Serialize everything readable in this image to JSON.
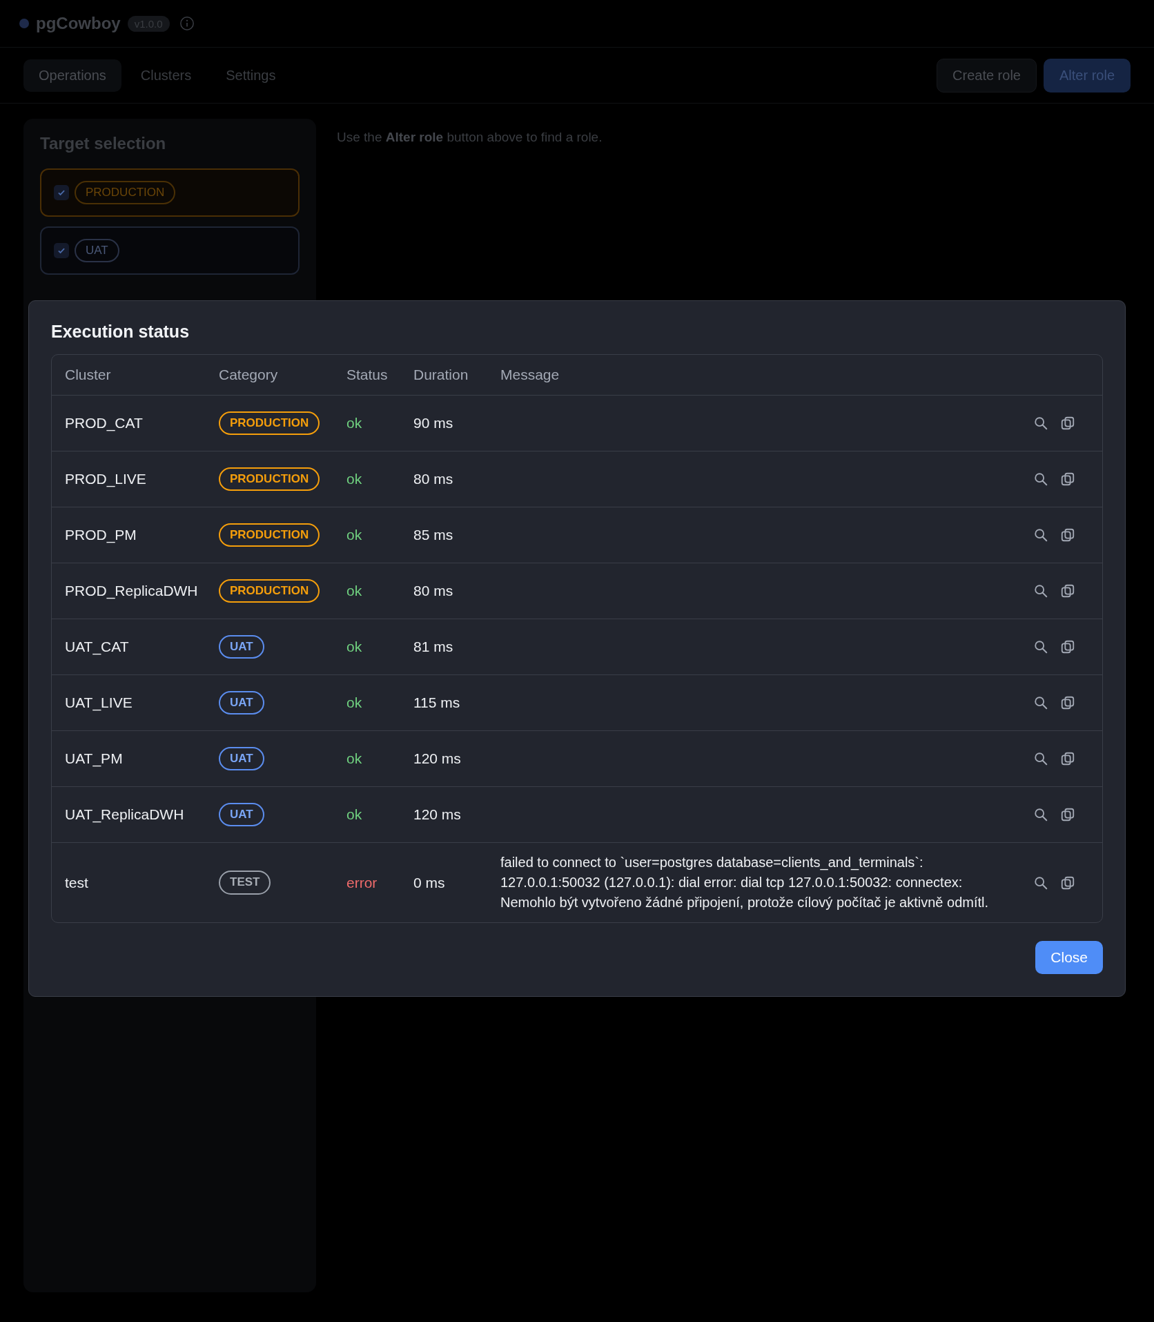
{
  "app": {
    "title": "pgCowboy",
    "version": "v1.0.0"
  },
  "tabs": [
    {
      "label": "Operations",
      "selected": true
    },
    {
      "label": "Clusters",
      "selected": false
    },
    {
      "label": "Settings",
      "selected": false
    }
  ],
  "actions": [
    {
      "label": "Create role",
      "kind": "secondary"
    },
    {
      "label": "Alter role",
      "kind": "primary"
    }
  ],
  "sidebar": {
    "title": "Target selection",
    "items": [
      {
        "label": "PRODUCTION",
        "kind": "production",
        "checked": true
      },
      {
        "label": "UAT",
        "kind": "uat",
        "checked": true
      }
    ]
  },
  "hint": "Use the **Alter role** button above to find a role.",
  "dialog": {
    "title": "Execution status",
    "columns": [
      "Cluster",
      "Category",
      "Status",
      "Duration",
      "Message"
    ],
    "rows": [
      {
        "cluster": "PROD_CAT",
        "category": {
          "label": "PRODUCTION",
          "kind": "production"
        },
        "status": {
          "text": "ok",
          "kind": "ok"
        },
        "duration": "90 ms"
      },
      {
        "cluster": "PROD_LIVE",
        "category": {
          "label": "PRODUCTION",
          "kind": "production"
        },
        "status": {
          "text": "ok",
          "kind": "ok"
        },
        "duration": "80 ms"
      },
      {
        "cluster": "PROD_PM",
        "category": {
          "label": "PRODUCTION",
          "kind": "production"
        },
        "status": {
          "text": "ok",
          "kind": "ok"
        },
        "duration": "85 ms"
      },
      {
        "cluster": "PROD_ReplicaDWH",
        "category": {
          "label": "PRODUCTION",
          "kind": "production"
        },
        "status": {
          "text": "ok",
          "kind": "ok"
        },
        "duration": "80 ms"
      },
      {
        "cluster": "UAT_CAT",
        "category": {
          "label": "UAT",
          "kind": "uat"
        },
        "status": {
          "text": "ok",
          "kind": "ok"
        },
        "duration": "81 ms"
      },
      {
        "cluster": "UAT_LIVE",
        "category": {
          "label": "UAT",
          "kind": "uat"
        },
        "status": {
          "text": "ok",
          "kind": "ok"
        },
        "duration": "115 ms"
      },
      {
        "cluster": "UAT_PM",
        "category": {
          "label": "UAT",
          "kind": "uat"
        },
        "status": {
          "text": "ok",
          "kind": "ok"
        },
        "duration": "120 ms"
      },
      {
        "cluster": "UAT_ReplicaDWH",
        "category": {
          "label": "UAT",
          "kind": "uat"
        },
        "status": {
          "text": "ok",
          "kind": "ok"
        },
        "duration": "120 ms"
      },
      {
        "cluster": "test",
        "category": {
          "label": "TEST",
          "kind": "test"
        },
        "status": {
          "text": "error",
          "kind": "error"
        },
        "duration": "0 ms",
        "message": "failed to connect to `user=postgres database=clients_and_terminals`: 127.0.0.1:50032 (127.0.0.1): dial error: dial tcp 127.0.0.1:50032: connectex: Nemohlo být vytvořeno žádné připojení, protože cílový počítač je aktivně odmítl."
      }
    ],
    "close": "Close"
  }
}
